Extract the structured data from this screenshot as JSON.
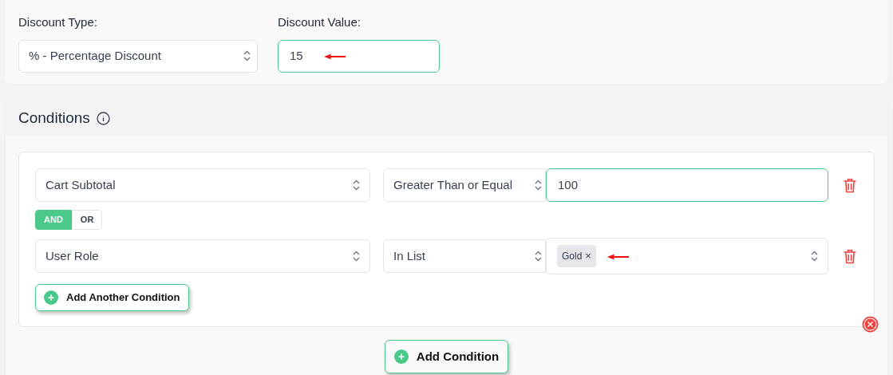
{
  "discount_type": {
    "label": "Discount Type:",
    "value": "% - Percentage Discount"
  },
  "discount_value": {
    "label": "Discount Value:",
    "value": "15",
    "focused": true
  },
  "conditions": {
    "title": "Conditions",
    "rows": [
      {
        "field": "Cart Subtotal",
        "operator": "Greater Than or Equal",
        "kind": "text",
        "value": "100",
        "focused": true
      },
      {
        "field": "User Role",
        "operator": "In List",
        "kind": "tags",
        "tags": [
          {
            "label": "Gold",
            "remove": "×"
          }
        ]
      }
    ],
    "connector": [
      {
        "label": "AND",
        "selected": true
      },
      {
        "label": "OR",
        "selected": false
      }
    ],
    "add_another": "Add Another Condition",
    "add": "Add Condition"
  }
}
